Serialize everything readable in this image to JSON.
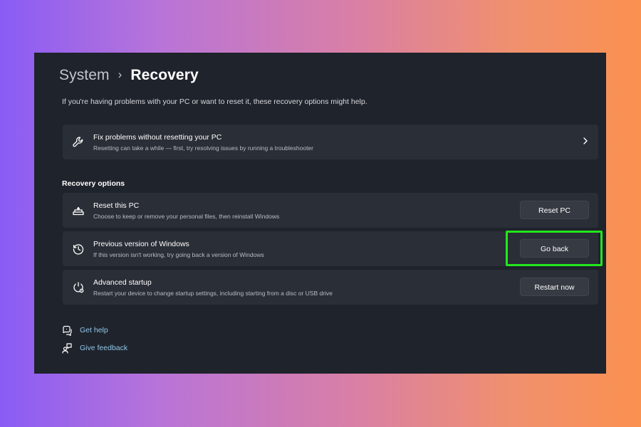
{
  "breadcrumb": {
    "parent": "System",
    "separator": "›",
    "current": "Recovery"
  },
  "intro": "If you're having problems with your PC or want to reset it, these recovery options might help.",
  "fix_card": {
    "icon": "wrench-icon",
    "title": "Fix problems without resetting your PC",
    "description": "Resetting can take a while — first, try resolving issues by running a troubleshooter"
  },
  "recovery_options": {
    "label": "Recovery options",
    "items": [
      {
        "icon": "reset-pc-icon",
        "title": "Reset this PC",
        "description": "Choose to keep or remove your personal files, then reinstall Windows",
        "button": "Reset PC"
      },
      {
        "icon": "history-icon",
        "title": "Previous version of Windows",
        "description": "If this version isn't working, try going back a version of Windows",
        "button": "Go back"
      },
      {
        "icon": "advanced-startup-icon",
        "title": "Advanced startup",
        "description": "Restart your device to change startup settings, including starting from a disc or USB drive",
        "button": "Restart now"
      }
    ]
  },
  "links": {
    "help": "Get help",
    "feedback": "Give feedback"
  },
  "colors": {
    "window_background": "#1f232b",
    "card_background": "#2a2e36",
    "link": "#93c6ea",
    "highlight": "#22e81c"
  }
}
